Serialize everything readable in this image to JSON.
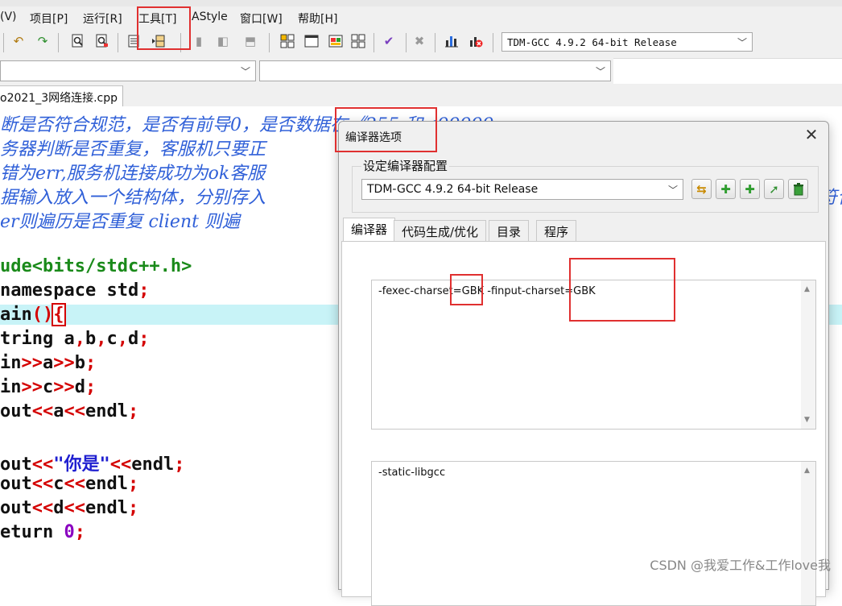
{
  "menu": {
    "items": [
      "(V)",
      "项目[P]",
      "运行[R]",
      "工具[T]",
      "AStyle",
      "窗口[W]",
      "帮助[H]"
    ]
  },
  "toolbar": {
    "compiler": "TDM-GCC 4.9.2 64-bit Release"
  },
  "file_tab": {
    "label": "o2021_3网络连接.cpp"
  },
  "editor": {
    "comment_lines": [
      "断是否符合规范，是否有前导0，是否数据在《255 和<99999",
      "务器判断是否重复，客服机只要正",
      "错为err,服务机连接成功为ok客服",
      "据输入放入一个结构体，分别存入",
      "er则遍历是否重复 client 则遍"
    ],
    "comment_tail": "符合"
  },
  "dialog": {
    "title": "编译器选项",
    "group_label": "设定编译器配置",
    "config_value": "TDM-GCC 4.9.2 64-bit Release",
    "tabs": [
      "编译器",
      "代码生成/优化",
      "目录",
      "程序"
    ],
    "compile_options": "-fexec-charset=GBK -finput-charset=GBK",
    "link_options": "-static-libgcc"
  },
  "watermark": "CSDN @我爱工作&工作love我",
  "colors": {
    "comment": "#3060d8",
    "keyword": "#111111",
    "symbol": "#d40000",
    "include": "#1a8a1a",
    "string": "#1f1fd0",
    "number": "#8a00c0",
    "current_line": "#c8f3f7",
    "annotation": "#e03030"
  }
}
